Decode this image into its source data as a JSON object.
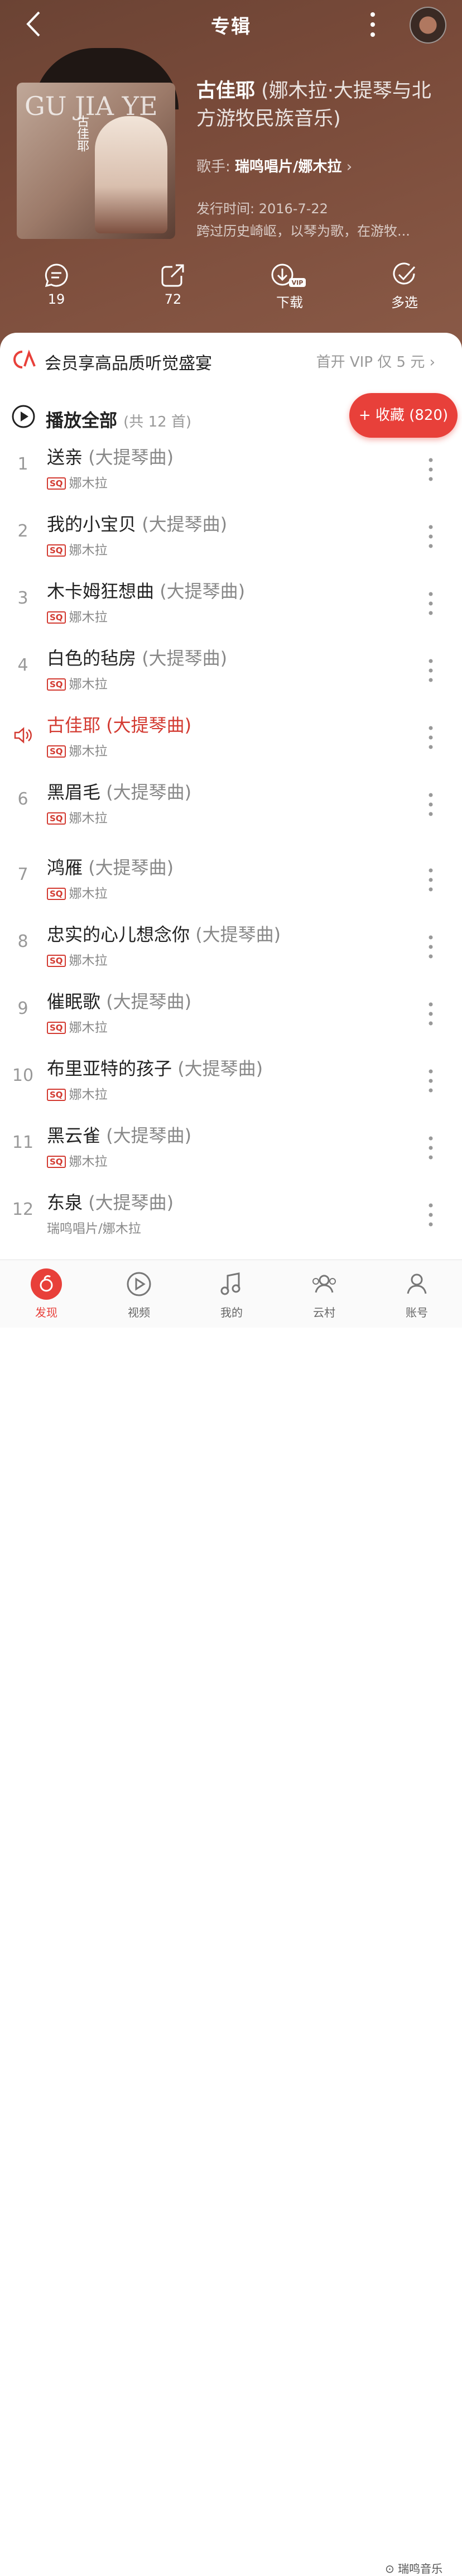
{
  "header": {
    "title": "专辑"
  },
  "album": {
    "title": "古佳耶",
    "title_sub": " (娜木拉·大提琴与北方游牧民族音乐)",
    "singer_label": "歌手: ",
    "singer_name": "瑞鸣唱片/娜木拉",
    "release": "发行时间: 2016-7-22",
    "description": "跨过历史崎岖，以琴为歌，在游牧...",
    "cover_letters": "GU JIA YE",
    "cover_cn": "古佳耶"
  },
  "actions": [
    {
      "label": "19",
      "icon": "comment-icon"
    },
    {
      "label": "72",
      "icon": "share-icon"
    },
    {
      "label": "下载",
      "icon": "download-icon"
    },
    {
      "label": "多选",
      "icon": "multi-select-icon"
    }
  ],
  "vip": {
    "text": "会员享高品质听觉盛宴",
    "promo": "首开 VIP 仅 5 元"
  },
  "playall": {
    "label": "播放全部",
    "count": "(共 12 首)",
    "collect": "+ 收藏 (820)"
  },
  "tag": "(大提琴曲)",
  "songs": [
    {
      "num": "1",
      "name": "送亲",
      "artist": "娜木拉",
      "sq": "SQ"
    },
    {
      "num": "2",
      "name": "我的小宝贝",
      "artist": "娜木拉",
      "sq": "SQ"
    },
    {
      "num": "3",
      "name": "木卡姆狂想曲",
      "artist": "娜木拉",
      "sq": "SQ"
    },
    {
      "num": "4",
      "name": "白色的毡房",
      "artist": "娜木拉",
      "sq": "SQ"
    },
    {
      "num": "",
      "name": "古佳耶",
      "artist": "娜木拉",
      "sq": "SQ"
    },
    {
      "num": "6",
      "name": "黑眉毛",
      "artist": "娜木拉",
      "sq": "SQ"
    },
    {
      "num": "7",
      "name": "鸿雁",
      "artist": "娜木拉",
      "sq": "SQ"
    },
    {
      "num": "8",
      "name": "忠实的心儿想念你",
      "artist": "娜木拉",
      "sq": "SQ"
    },
    {
      "num": "9",
      "name": "催眠歌",
      "artist": "娜木拉",
      "sq": "SQ"
    },
    {
      "num": "10",
      "name": "布里亚特的孩子",
      "artist": "娜木拉",
      "sq": "SQ"
    },
    {
      "num": "11",
      "name": "黑云雀",
      "artist": "娜木拉",
      "sq": "SQ"
    },
    {
      "num": "12",
      "name": "东泉",
      "artist": "瑞鸣唱片/娜木拉",
      "sq": ""
    }
  ],
  "tabs": [
    {
      "label": "发现"
    },
    {
      "label": "视频"
    },
    {
      "label": "我的"
    },
    {
      "label": "云村"
    },
    {
      "label": "账号"
    }
  ],
  "watermark": "瑞鸣音乐",
  "colors": {
    "accent": "#e8403a",
    "playing": "#d33a31",
    "hero": "#7a4b3a"
  }
}
